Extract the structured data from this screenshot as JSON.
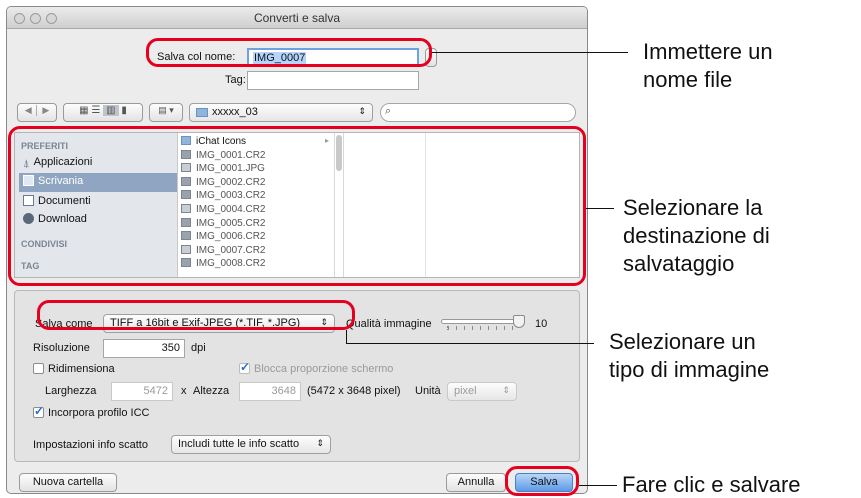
{
  "window": {
    "title": "Converti e salva"
  },
  "save": {
    "name_label": "Salva col nome:",
    "name_value": "IMG_0007",
    "tag_label": "Tag:"
  },
  "toolbar": {
    "location": "xxxxx_03",
    "search_placeholder": ""
  },
  "sidebar": {
    "favorites_heading": "PREFERITI",
    "items": [
      {
        "label": "Applicazioni",
        "icon": "applications-icon"
      },
      {
        "label": "Scrivania",
        "icon": "desktop-icon",
        "selected": true
      },
      {
        "label": "Documenti",
        "icon": "documents-icon"
      },
      {
        "label": "Download",
        "icon": "downloads-icon"
      }
    ],
    "shared_heading": "CONDIVISI",
    "tags_heading": "TAG"
  },
  "files": [
    {
      "name": "iChat Icons",
      "type": "folder"
    },
    {
      "name": "IMG_0001.CR2",
      "type": "file"
    },
    {
      "name": "IMG_0001.JPG",
      "type": "file"
    },
    {
      "name": "IMG_0002.CR2",
      "type": "file"
    },
    {
      "name": "IMG_0003.CR2",
      "type": "file"
    },
    {
      "name": "IMG_0004.CR2",
      "type": "file"
    },
    {
      "name": "IMG_0005.CR2",
      "type": "file"
    },
    {
      "name": "IMG_0006.CR2",
      "type": "file"
    },
    {
      "name": "IMG_0007.CR2",
      "type": "file"
    },
    {
      "name": "IMG_0008.CR2",
      "type": "file"
    }
  ],
  "options": {
    "save_as_label": "Salva come",
    "save_as_value": "TIFF a 16bit e Exif-JPEG (*.TIF, *.JPG)",
    "quality_label": "Qualità immagine",
    "quality_value": "10",
    "quality_level": 1.0,
    "resolution_label": "Risoluzione",
    "resolution_value": "350",
    "resolution_unit": "dpi",
    "resize_label": "Ridimensiona",
    "resize_checked": false,
    "lock_ratio_label": "Blocca proporzione schermo",
    "lock_ratio_checked": true,
    "width_label": "Larghezza",
    "width_value": "5472",
    "times": "x",
    "height_label": "Altezza",
    "height_value": "3648",
    "dims_text": "(5472 x 3648 pixel)",
    "unit_label": "Unità",
    "unit_value": "pixel",
    "embed_icc_label": "Incorpora profilo ICC",
    "embed_icc_checked": true,
    "shot_info_label": "Impostazioni info scatto",
    "shot_info_value": "Includi tutte le info scatto"
  },
  "buttons": {
    "new_folder": "Nuova cartella",
    "cancel": "Annulla",
    "save": "Salva"
  },
  "callouts": {
    "name": [
      "Immettere un",
      "nome file"
    ],
    "destination": [
      "Selezionare la",
      "destinazione di",
      "salvataggio"
    ],
    "type": [
      "Selezionare un",
      "tipo di immagine"
    ],
    "save": "Fare clic e salvare"
  },
  "colors": {
    "highlight_red": "#e5001f",
    "accent_blue": "#2a6bd1",
    "selected_sidebar": "#8fa5c2"
  }
}
